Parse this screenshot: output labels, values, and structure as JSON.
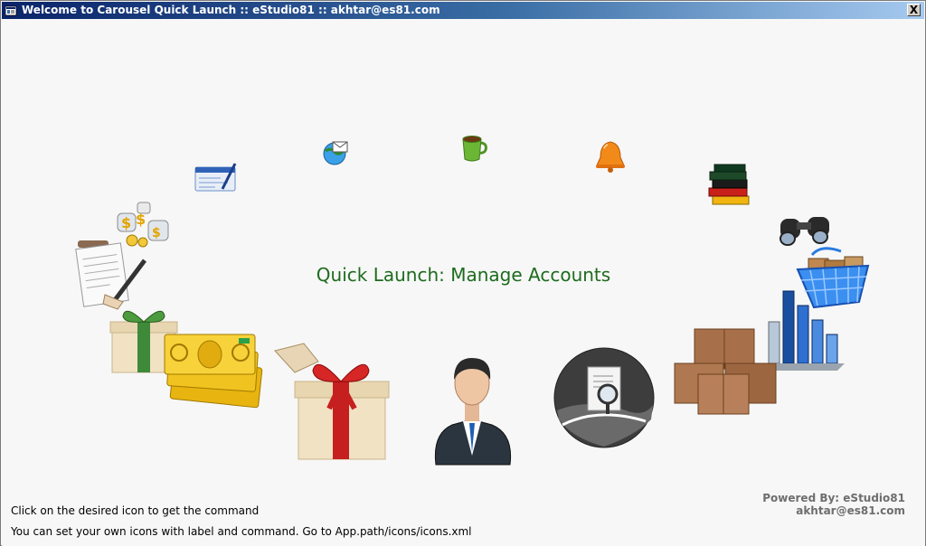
{
  "window": {
    "title": "Welcome to Carousel Quick Launch :: eStudio81 :: akhtar@es81.com",
    "close_label": "X"
  },
  "carousel": {
    "current_label": "Quick Launch: Manage Accounts",
    "items": [
      {
        "name": "checkbook-icon"
      },
      {
        "name": "globe-email-icon"
      },
      {
        "name": "coffee-cup-icon"
      },
      {
        "name": "bell-icon"
      },
      {
        "name": "books-icon"
      },
      {
        "name": "money-bags-icon"
      },
      {
        "name": "binoculars-icon"
      },
      {
        "name": "invoice-signing-icon"
      },
      {
        "name": "shopping-basket-icon"
      },
      {
        "name": "gift-box-green-icon"
      },
      {
        "name": "bar-chart-icon"
      },
      {
        "name": "banknotes-icon"
      },
      {
        "name": "cardboard-boxes-icon"
      },
      {
        "name": "gift-box-red-icon"
      },
      {
        "name": "business-user-icon"
      },
      {
        "name": "document-search-icon"
      }
    ]
  },
  "footer": {
    "hint_click": "Click on the desired icon to get the command",
    "hint_custom": "You can set your own icons with label and command. Go to App.path/icons/icons.xml",
    "powered_by": "Powered By: eStudio81",
    "email": "akhtar@es81.com"
  }
}
